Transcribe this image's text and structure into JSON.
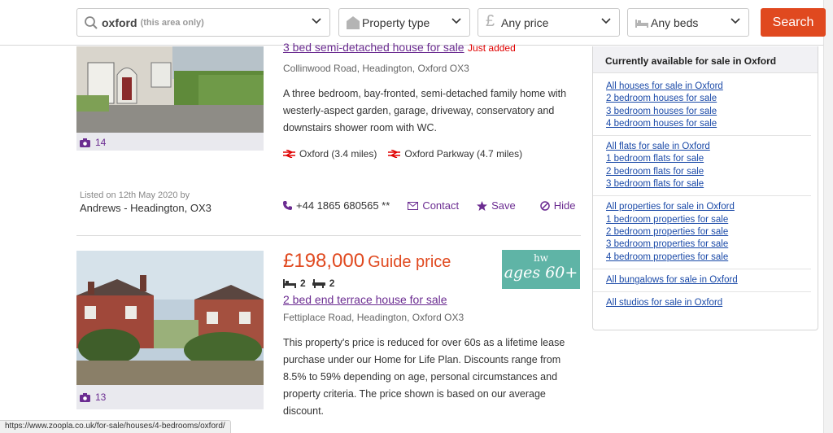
{
  "search": {
    "location_value": "oxford",
    "location_hint": "(this area only)",
    "property_type": "Property type",
    "price": "Any price",
    "beds": "Any beds",
    "button": "Search"
  },
  "listings": [
    {
      "title": "3 bed semi-detached house for sale",
      "just_added": "Just added",
      "address": "Collinwood Road, Headington, Oxford OX3",
      "description": "A three bedroom, bay-fronted, semi-detached family home with westerly-aspect garden, garage, driveway, conservatory and downstairs shower room with WC.",
      "stations": [
        {
          "label": "Oxford (3.4 miles)"
        },
        {
          "label": "Oxford Parkway (4.7 miles)"
        }
      ],
      "photo_count": "14",
      "listed_on": "Listed on 12th May 2020 by",
      "agent": "Andrews - Headington, OX3",
      "phone": "+44 1865 680565 **",
      "contact": "Contact",
      "save": "Save",
      "hide": "Hide"
    },
    {
      "price": "£198,000",
      "price_qualifier": "Guide price",
      "beds": "2",
      "baths": "2",
      "title": "2 bed end terrace house for sale",
      "address": "Fettiplace Road, Headington, Oxford OX3",
      "description": "This property's price is reduced for over 60s as a lifetime lease purchase under our Home for Life Plan. Discounts range from 8.5% to 59% depending on age, personal circumstances and property criteria. The price shown is based on our average discount.",
      "photo_count": "13",
      "badge_top": "hw",
      "badge_main": "ages 60+"
    }
  ],
  "sidepanel": {
    "heading": "Currently available for sale in Oxford",
    "groups": [
      [
        "All houses for sale in Oxford",
        "2 bedroom houses for sale",
        "3 bedroom houses for sale",
        "4 bedroom houses for sale"
      ],
      [
        "All flats for sale in Oxford",
        "1 bedroom flats for sale",
        "2 bedroom flats for sale",
        "3 bedroom flats for sale"
      ],
      [
        "All properties for sale in Oxford",
        "1 bedroom properties for sale",
        "2 bedroom properties for sale",
        "3 bedroom properties for sale",
        "4 bedroom properties for sale"
      ],
      [
        "All bungalows for sale in Oxford"
      ],
      [
        "All studios for sale in Oxford"
      ]
    ]
  },
  "status_url": "https://www.zoopla.co.uk/for-sale/houses/4-bedrooms/oxford/",
  "colors": {
    "accent": "#e0491f",
    "link_purple": "#6b2c91",
    "link_blue": "#1b4aa8",
    "badge": "#5fb4a6"
  }
}
